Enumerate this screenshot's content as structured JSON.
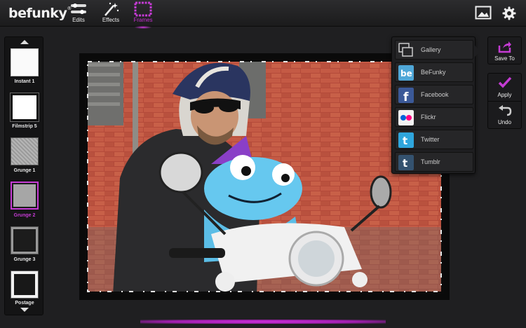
{
  "app": {
    "logo_text": "befunky"
  },
  "toolbar": {
    "edits_label": "Edits",
    "effects_label": "Effects",
    "frames_label": "Frames",
    "active_tool": "Frames",
    "accent_color": "#c43bd3"
  },
  "frames": [
    {
      "label": "Instant 1"
    },
    {
      "label": "Filmstrip 5"
    },
    {
      "label": "Grunge 1"
    },
    {
      "label": "Grunge 2",
      "selected": true
    },
    {
      "label": "Grunge 3"
    },
    {
      "label": "Postage"
    }
  ],
  "share_menu": {
    "items": [
      {
        "label": "Gallery",
        "icon": "gallery-icon"
      },
      {
        "label": "BeFunky",
        "icon": "befunky-icon"
      },
      {
        "label": "Facebook",
        "icon": "facebook-icon"
      },
      {
        "label": "Flickr",
        "icon": "flickr-icon"
      },
      {
        "label": "Twitter",
        "icon": "twitter-icon"
      },
      {
        "label": "Tumblr",
        "icon": "tumblr-icon"
      }
    ]
  },
  "actions": {
    "save_label": "Save To",
    "apply_label": "Apply",
    "undo_label": "Undo"
  }
}
